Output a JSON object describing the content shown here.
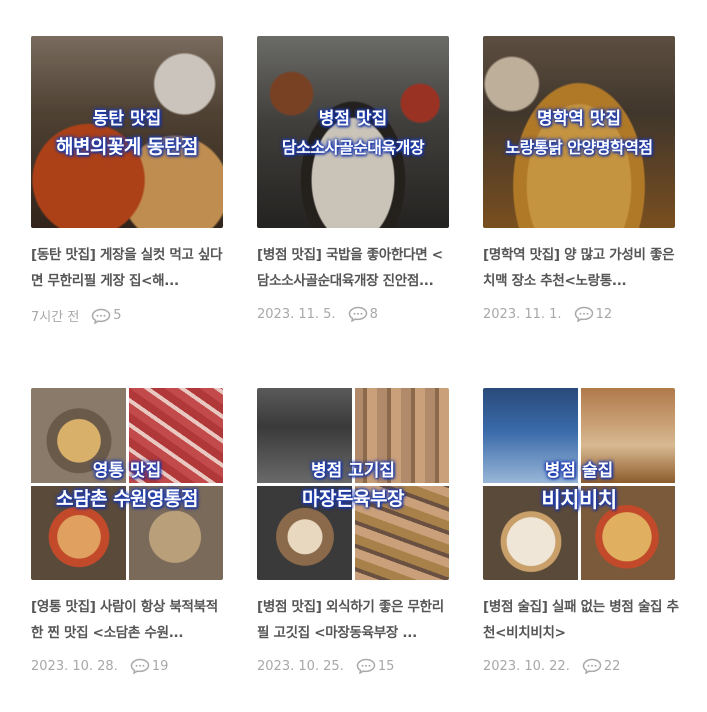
{
  "posts": [
    {
      "cap1": "동탄 맛집",
      "cap2": "해변의꽃게 동탄점",
      "title": "[동탄 맛집] 게장을 실컷 먹고 싶다면 무한리필 게장 집<해...",
      "date": "7시간 전",
      "comments": "5",
      "icon": "comment-icon",
      "palette": [
        "#6b4a2e",
        "#c44a1c",
        "#d9a15a",
        "#4a3a2c"
      ]
    },
    {
      "cap1": "병점 맛집",
      "cap2": "담소소사골순대육개장",
      "title": "[병점 맛집] 국밥을 좋아한다면 <담소소사골순대육개장 진안점...",
      "date": "2023. 11. 5.",
      "comments": "8",
      "icon": "comment-icon",
      "palette": [
        "#3a3632",
        "#ded8cc",
        "#8a7d6a",
        "#2a2622"
      ]
    },
    {
      "cap1": "명학역 맛집",
      "cap2": "노랑통닭 안양명학역점",
      "title": "[명학역 맛집] 양 많고 가성비 좋은 치맥 장소 추천<노랑통...",
      "date": "2023. 11. 1.",
      "comments": "12",
      "icon": "comment-icon",
      "palette": [
        "#5a4a3a",
        "#c98a2e",
        "#e0a94a",
        "#8a5a24"
      ]
    },
    {
      "cap1": "영통 맛집",
      "cap2": "소담촌 수원영통점",
      "title": "[영통 맛집] 사람이 항상 북적북적한 찐 맛집 <소담촌 수원...",
      "date": "2023. 10. 28.",
      "comments": "19",
      "icon": "comment-icon",
      "palette": [
        "#6a5a4a",
        "#c24a4a",
        "#d9b06a",
        "#9a7a4a"
      ]
    },
    {
      "cap1": "병점 고기집",
      "cap2": "마장돈육부장",
      "title": "[병점 맛집] 외식하기 좋은 무한리필 고깃집 <마장동육부장 ...",
      "date": "2023. 10. 25.",
      "comments": "15",
      "icon": "comment-icon",
      "palette": [
        "#4a4a4a",
        "#b08a6a",
        "#8a6a4a",
        "#c9a07a"
      ]
    },
    {
      "cap1": "병점 술집",
      "cap2": "비치비치",
      "title": "[병점 술집] 실패 없는 병점 술집 추천<비치비치>",
      "date": "2023. 10. 22.",
      "comments": "22",
      "icon": "comment-icon",
      "palette": [
        "#3a5a8a",
        "#c9a06a",
        "#e8d8c0",
        "#b07a3a"
      ]
    }
  ]
}
